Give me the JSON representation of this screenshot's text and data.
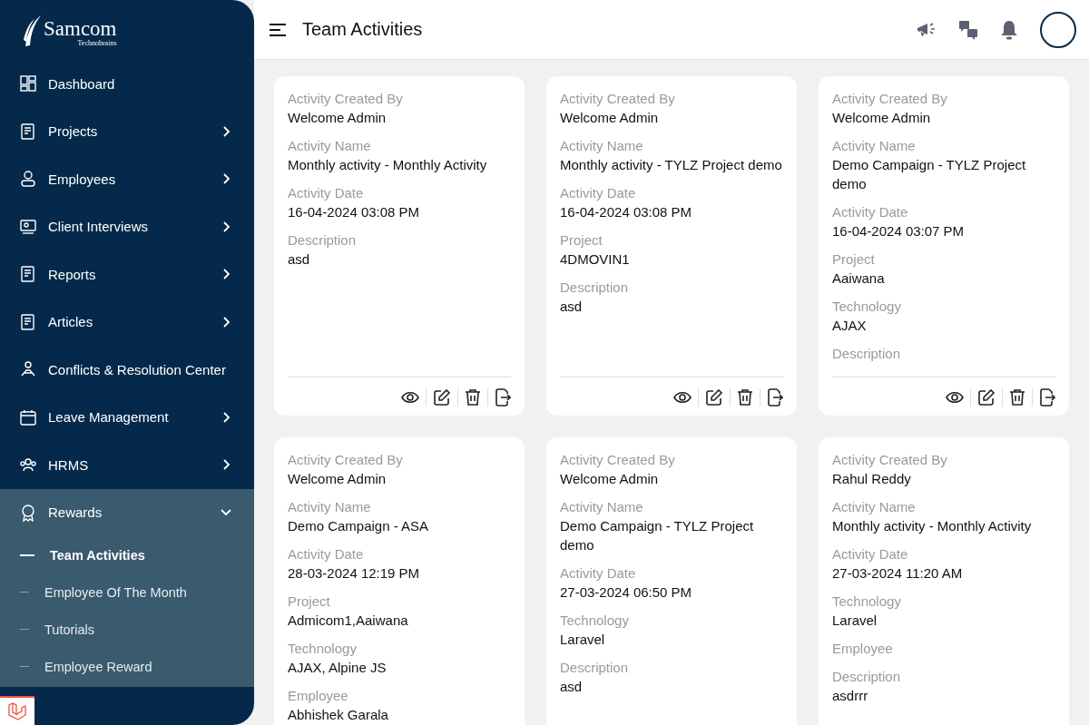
{
  "brand": {
    "name": "Samcom",
    "tagline": "Technobrains"
  },
  "nav": [
    {
      "label": "Dashboard",
      "has_children": false,
      "expanded": false
    },
    {
      "label": "Projects",
      "has_children": true,
      "expanded": false
    },
    {
      "label": "Employees",
      "has_children": true,
      "expanded": false
    },
    {
      "label": "Client Interviews",
      "has_children": true,
      "expanded": false
    },
    {
      "label": "Reports",
      "has_children": true,
      "expanded": false
    },
    {
      "label": "Articles",
      "has_children": true,
      "expanded": false
    },
    {
      "label": "Conflicts & Resolution Center",
      "has_children": false,
      "expanded": false
    },
    {
      "label": "Leave Management",
      "has_children": true,
      "expanded": false
    },
    {
      "label": "HRMS",
      "has_children": true,
      "expanded": false
    },
    {
      "label": "Rewards",
      "has_children": true,
      "expanded": true,
      "children": [
        {
          "label": "Team Activities",
          "selected": true
        },
        {
          "label": "Employee Of The Month",
          "selected": false
        },
        {
          "label": "Tutorials",
          "selected": false
        },
        {
          "label": "Employee Reward",
          "selected": false
        }
      ]
    }
  ],
  "header": {
    "title": "Team Activities"
  },
  "cards": [
    {
      "fields": [
        {
          "label": "Activity Created By",
          "value": "Welcome Admin"
        },
        {
          "label": "Activity Name",
          "value": "Monthly activity - Monthly Activity"
        },
        {
          "label": "Activity Date",
          "value": "16-04-2024 03:08 PM"
        },
        {
          "label": "Description",
          "value": "asd"
        }
      ],
      "actions": [
        {
          "kind": "view"
        },
        {
          "kind": "edit"
        },
        {
          "kind": "delete"
        },
        {
          "kind": "export"
        }
      ]
    },
    {
      "fields": [
        {
          "label": "Activity Created By",
          "value": "Welcome Admin"
        },
        {
          "label": "Activity Name",
          "value": "Monthly activity - TYLZ Project demo"
        },
        {
          "label": "Activity Date",
          "value": "16-04-2024 03:08 PM"
        },
        {
          "label": "Project",
          "value": "4DMOVIN1"
        },
        {
          "label": "Description",
          "value": "asd"
        }
      ],
      "actions": [
        {
          "kind": "view"
        },
        {
          "kind": "edit"
        },
        {
          "kind": "delete"
        },
        {
          "kind": "export"
        }
      ]
    },
    {
      "fields": [
        {
          "label": "Activity Created By",
          "value": "Welcome Admin"
        },
        {
          "label": "Activity Name",
          "value": "Demo Campaign - TYLZ Project demo"
        },
        {
          "label": "Activity Date",
          "value": "16-04-2024 03:07 PM"
        },
        {
          "label": "Project",
          "value": "Aaiwana"
        },
        {
          "label": "Technology",
          "value": "AJAX"
        },
        {
          "label": "Description"
        }
      ],
      "actions": [
        {
          "kind": "view"
        },
        {
          "kind": "edit"
        },
        {
          "kind": "delete"
        },
        {
          "kind": "export"
        }
      ]
    },
    {
      "fields": [
        {
          "label": "Activity Created By",
          "value": "Welcome Admin"
        },
        {
          "label": "Activity Name",
          "value": "Demo Campaign - ASA"
        },
        {
          "label": "Activity Date",
          "value": "28-03-2024 12:19 PM"
        },
        {
          "label": "Project",
          "value": "Admicom1,Aaiwana"
        },
        {
          "label": "Technology",
          "value": "AJAX, Alpine JS"
        },
        {
          "label": "Employee",
          "value": "Abhishek Garala"
        }
      ]
    },
    {
      "fields": [
        {
          "label": "Activity Created By",
          "value": "Welcome Admin"
        },
        {
          "label": "Activity Name",
          "value": "Demo Campaign - TYLZ Project demo"
        },
        {
          "label": "Activity Date",
          "value": "27-03-2024 06:50 PM"
        },
        {
          "label": "Technology",
          "value": "Laravel"
        },
        {
          "label": "Description",
          "value": "asd"
        }
      ]
    },
    {
      "fields": [
        {
          "label": "Activity Created By",
          "value": "Rahul Reddy"
        },
        {
          "label": "Activity Name",
          "value": "Monthly activity - Monthly Activity"
        },
        {
          "label": "Activity Date",
          "value": "27-03-2024 11:20 AM"
        },
        {
          "label": "Technology",
          "value": "Laravel"
        },
        {
          "label": "Employee"
        },
        {
          "label": "Description",
          "value": "asdrrr"
        }
      ]
    }
  ]
}
